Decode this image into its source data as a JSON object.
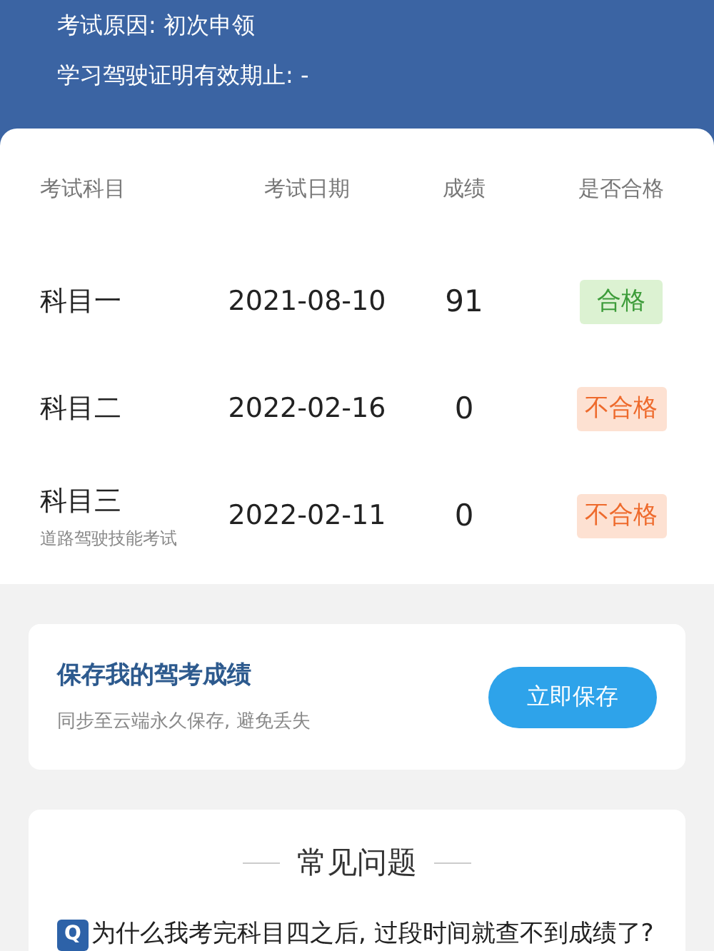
{
  "header": {
    "lines": [
      "考试原因: 初次申领",
      "学习驾驶证明有效期止: -"
    ]
  },
  "results": {
    "columns": [
      "考试科目",
      "考试日期",
      "成绩",
      "是否合格"
    ],
    "rows": [
      {
        "subject": "科目一",
        "date": "2021-08-10",
        "score": "91",
        "result": "合格",
        "passed": true
      },
      {
        "subject": "科目二",
        "date": "2022-02-16",
        "score": "0",
        "result": "不合格",
        "passed": false
      },
      {
        "subject": "科目三",
        "subtitle": "道路驾驶技能考试",
        "date": "2022-02-11",
        "score": "0",
        "result": "不合格",
        "passed": false
      }
    ]
  },
  "save_card": {
    "title": "保存我的驾考成绩",
    "subtitle": "同步至云端永久保存, 避免丢失",
    "button": "立即保存"
  },
  "faq": {
    "title": "常见问题",
    "questions": [
      {
        "badge": "Q",
        "text": "为什么我考完科目四之后, 过段时间就查不到成绩了?"
      }
    ]
  }
}
